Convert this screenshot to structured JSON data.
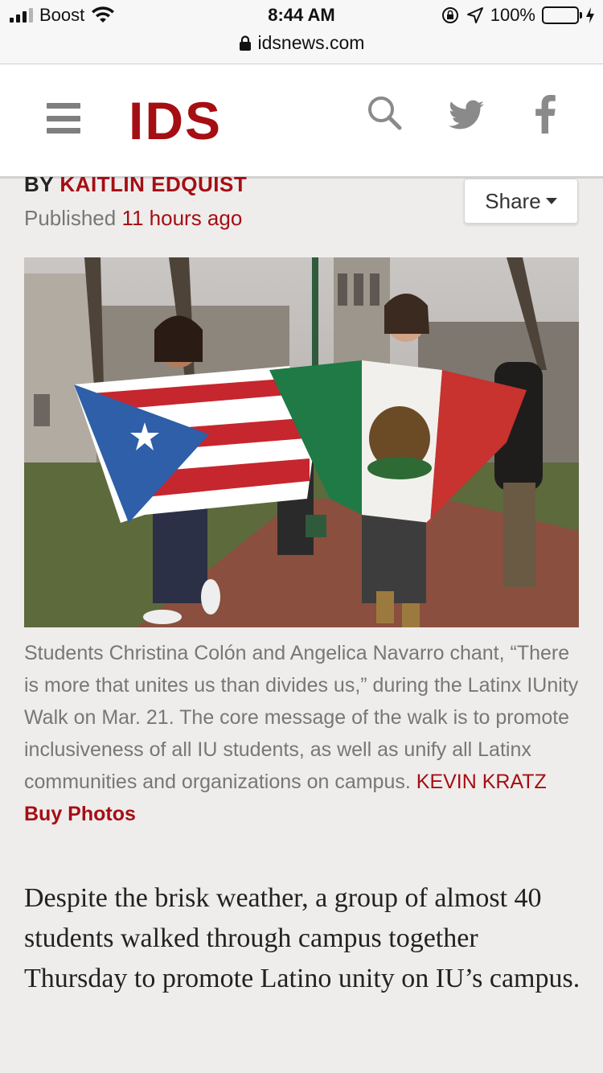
{
  "status_bar": {
    "carrier": "Boost",
    "time": "8:44 AM",
    "battery": "100%",
    "url": "idsnews.com",
    "icons": [
      "signal-icon",
      "wifi-icon",
      "lock-rotation-icon",
      "location-icon",
      "battery-icon",
      "charging-icon",
      "lock-icon"
    ]
  },
  "header": {
    "logo": "IDS",
    "brand_color": "#a50e13",
    "icons": [
      "menu-icon",
      "search-icon",
      "twitter-icon",
      "facebook-icon"
    ]
  },
  "article": {
    "byline_prefix": "BY",
    "author": "KAITLIN EDQUIST",
    "published_prefix": "Published",
    "published_ago": "11 hours ago",
    "share_label": "Share",
    "caption": "Students Christina Colón and Angelica Navarro chant, “There is more that unites us than divides us,” during the Latinx IUnity Walk on Mar. 21. The core message of the walk is to promote inclusiveness of all IU students, as well as unify all Latinx communities and organizations on campus.",
    "photo_credit": "KEVIN KRATZ",
    "buy_photos": "Buy Photos",
    "lede": "Despite the brisk weather, a group of almost 40 students walked through campus together Thursday to promote Latino unity on IU’s campus."
  }
}
